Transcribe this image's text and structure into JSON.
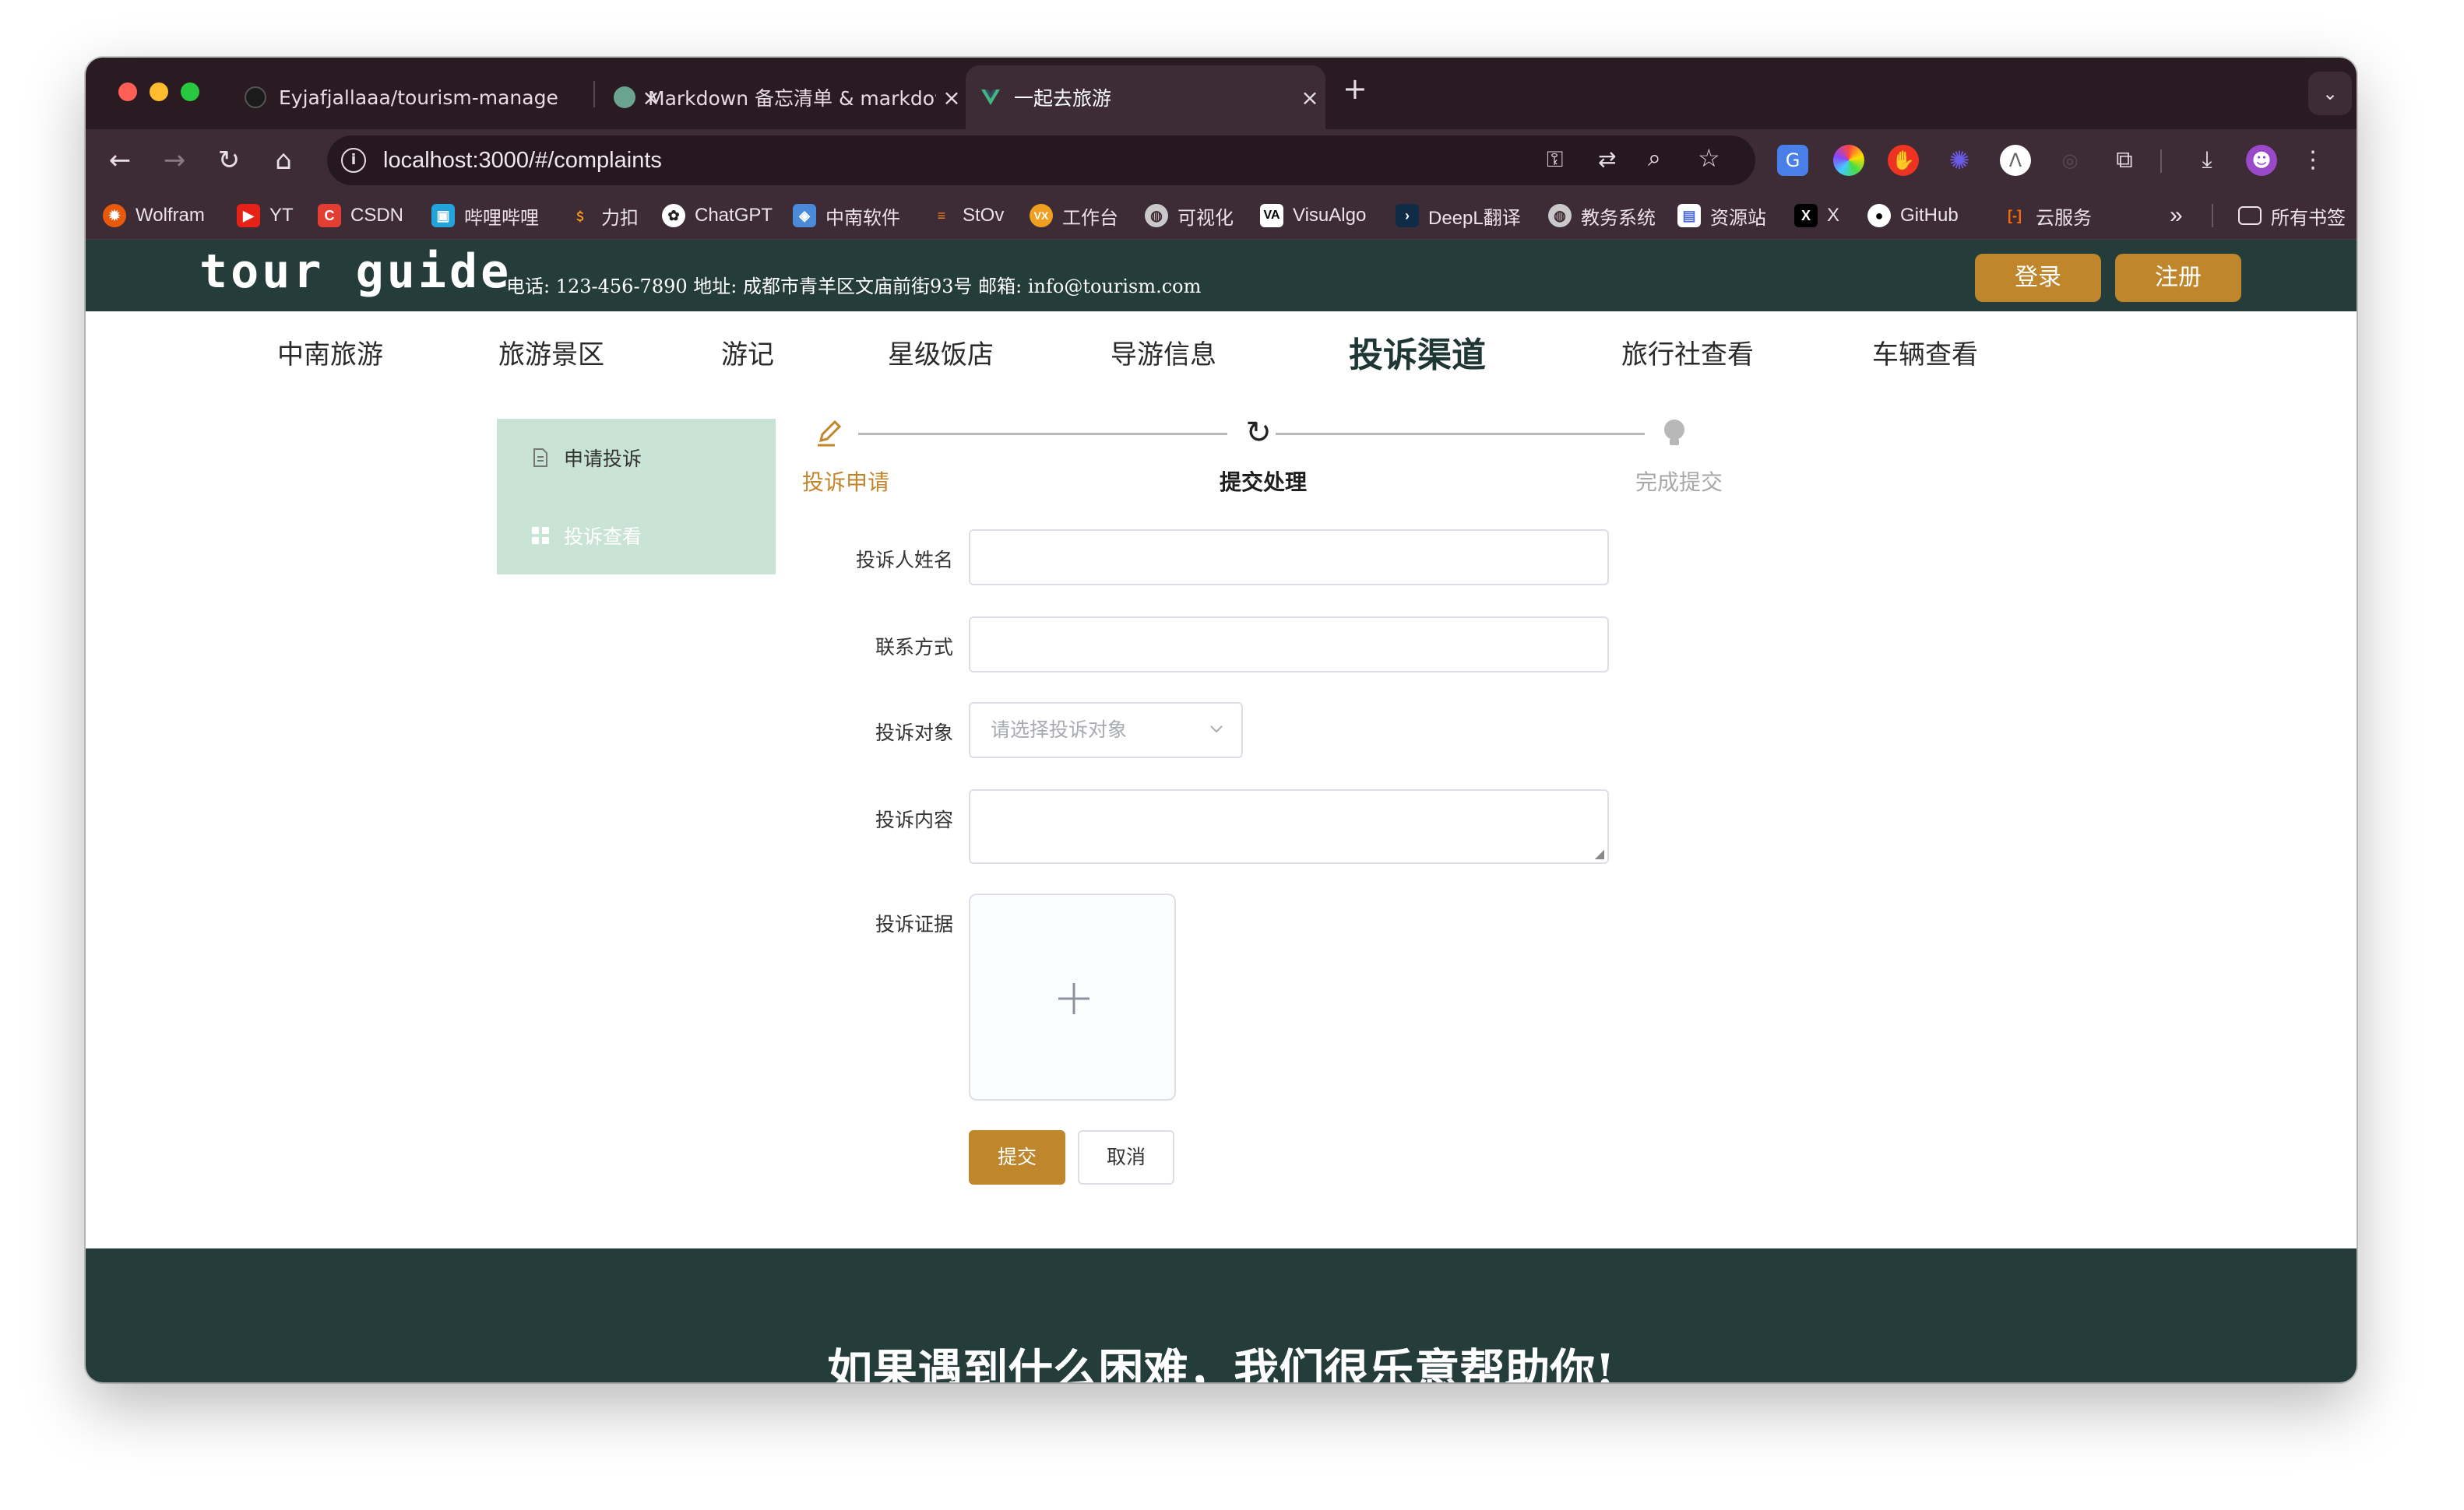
{
  "browser": {
    "tabs": [
      {
        "title": "Eyjafjallaaa/tourism-manage",
        "favicon": "github-icon"
      },
      {
        "title": "Markdown 备忘清单 & markdown",
        "favicon": "doc-icon"
      },
      {
        "title": "一起去旅游",
        "favicon": "vue-icon",
        "active": true
      }
    ],
    "new_tab": "+",
    "url": "localhost:3000/#/complaints",
    "bookmarks": [
      {
        "label": "Wolfram",
        "icon": "wolfram-icon",
        "color": "#e8590c"
      },
      {
        "label": "YT",
        "icon": "youtube-icon",
        "color": "#e62117"
      },
      {
        "label": "CSDN",
        "icon": "csdn-icon",
        "color": "#e33e33"
      },
      {
        "label": "哔哩哔哩",
        "icon": "bilibili-icon",
        "color": "#23a3dc"
      },
      {
        "label": "力扣",
        "icon": "leetcode-icon",
        "color": "#f89f1b"
      },
      {
        "label": "ChatGPT",
        "icon": "chatgpt-icon",
        "color": "#ffffff"
      },
      {
        "label": "中南软件",
        "icon": "csu-icon",
        "color": "#4a8ad8"
      },
      {
        "label": "StOv",
        "icon": "stackoverflow-icon",
        "color": "#f48024"
      },
      {
        "label": "工作台",
        "icon": "vx-icon",
        "color": "#f0a020"
      },
      {
        "label": "可视化",
        "icon": "globe-icon",
        "color": "#c9c9c9"
      },
      {
        "label": "VisuAlgo",
        "icon": "visualgo-icon",
        "color": "#ffffff"
      },
      {
        "label": "DeepL翻译",
        "icon": "deepl-icon",
        "color": "#0f2b46"
      },
      {
        "label": "教务系统",
        "icon": "globe-icon",
        "color": "#c9c9c9"
      },
      {
        "label": "资源站",
        "icon": "resource-icon",
        "color": "#ffffff"
      },
      {
        "label": "X",
        "icon": "x-icon",
        "color": "#000000"
      },
      {
        "label": "GitHub",
        "icon": "github-icon",
        "color": "#ffffff"
      },
      {
        "label": "云服务",
        "icon": "cloud-icon",
        "color": "#ff6a00"
      }
    ],
    "more_bookmarks": "»",
    "all_bookmarks": "所有书签"
  },
  "site": {
    "logo": "tour guide",
    "contact": "电话: 123-456-7890 地址: 成都市青羊区文庙前街93号 邮箱: info@tourism.com",
    "login": "登录",
    "register": "注册",
    "nav": [
      "中南旅游",
      "旅游景区",
      "游记",
      "星级饭店",
      "导游信息",
      "投诉渠道",
      "旅行社查看",
      "车辆查看"
    ],
    "active_nav": "投诉渠道"
  },
  "sidemenu": {
    "items": [
      {
        "label": "申请投诉",
        "icon": "document-icon",
        "active": true
      },
      {
        "label": "投诉查看",
        "icon": "grid-icon",
        "active": false
      }
    ]
  },
  "steps": [
    {
      "label": "投诉申请",
      "icon": "edit-icon",
      "status": "finished"
    },
    {
      "label": "提交处理",
      "icon": "refresh-icon",
      "status": "process"
    },
    {
      "label": "完成提交",
      "icon": "lightbulb-icon",
      "status": "wait"
    }
  ],
  "form": {
    "name_label": "投诉人姓名",
    "name_value": "",
    "contact_label": "联系方式",
    "contact_value": "",
    "target_label": "投诉对象",
    "target_placeholder": "请选择投诉对象",
    "content_label": "投诉内容",
    "content_value": "",
    "evidence_label": "投诉证据",
    "submit": "提交",
    "cancel": "取消"
  },
  "footer": {
    "title": "如果遇到什么困难，我们很乐意帮助你!"
  },
  "colors": {
    "header_bg": "#243c3a",
    "accent": "#c0862c",
    "sidemenu_bg": "#c9e3d5"
  }
}
